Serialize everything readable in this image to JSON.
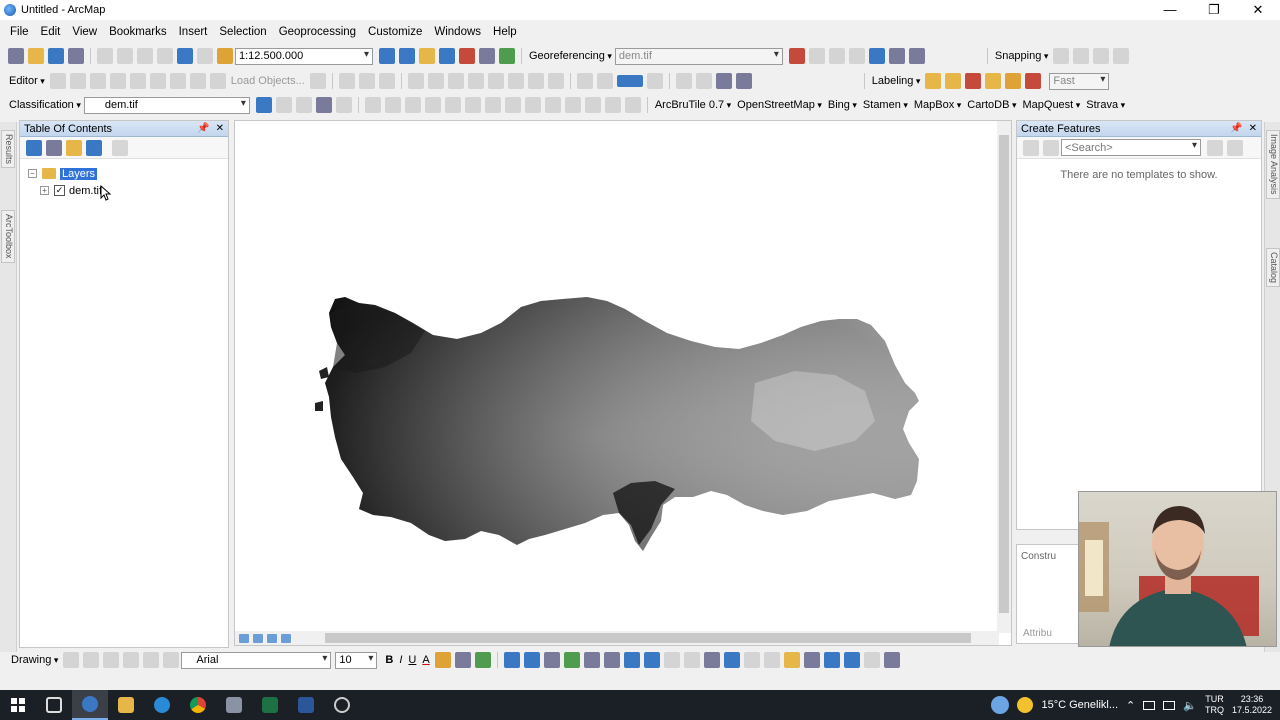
{
  "window": {
    "title": "Untitled - ArcMap",
    "controls": [
      "—",
      "❐",
      "✕"
    ]
  },
  "menu": [
    "File",
    "Edit",
    "View",
    "Bookmarks",
    "Insert",
    "Selection",
    "Geoprocessing",
    "Customize",
    "Windows",
    "Help"
  ],
  "toolbar1": {
    "scale": "1:12.500.000",
    "georeferencing_label": "Georeferencing",
    "georef_layer": "dem.tif",
    "snapping_label": "Snapping"
  },
  "toolbar2": {
    "editor_label": "Editor",
    "load_objects_label": "Load Objects...",
    "labeling_label": "Labeling",
    "fast_value": "Fast"
  },
  "toolbar3": {
    "classification_label": "Classification",
    "layer_value": "dem.tif",
    "plugins": [
      "ArcBruTile 0.7",
      "OpenStreetMap",
      "Bing",
      "Stamen",
      "MapBox",
      "CartoDB",
      "MapQuest",
      "Strava"
    ]
  },
  "left_tabs": [
    "Results",
    "ArcToolbox"
  ],
  "right_tabs": [
    "Image Analysis",
    "Catalog"
  ],
  "toc": {
    "title": "Table Of Contents",
    "root": "Layers",
    "layers": [
      {
        "name": "dem.tif",
        "checked": true
      }
    ]
  },
  "create_features": {
    "title": "Create Features",
    "search_placeholder": "<Search>",
    "empty_message": "There are no templates to show.",
    "construct_label": "Constru",
    "attribute_label": "Attribu"
  },
  "drawing": {
    "label": "Drawing",
    "font": "Arial",
    "size": "10",
    "bold": "B",
    "italic": "I",
    "underline": "U",
    "font_color": "A"
  },
  "taskbar": {
    "weather": "15°C  Genelikl...",
    "lang_top": "TUR",
    "lang_bottom": "TRQ",
    "time": "23:36",
    "date": "17.5.2022"
  },
  "colors": {
    "accent": "#3072d7",
    "panel_header": "#c9dbf0",
    "taskbar": "#1b1f26"
  }
}
